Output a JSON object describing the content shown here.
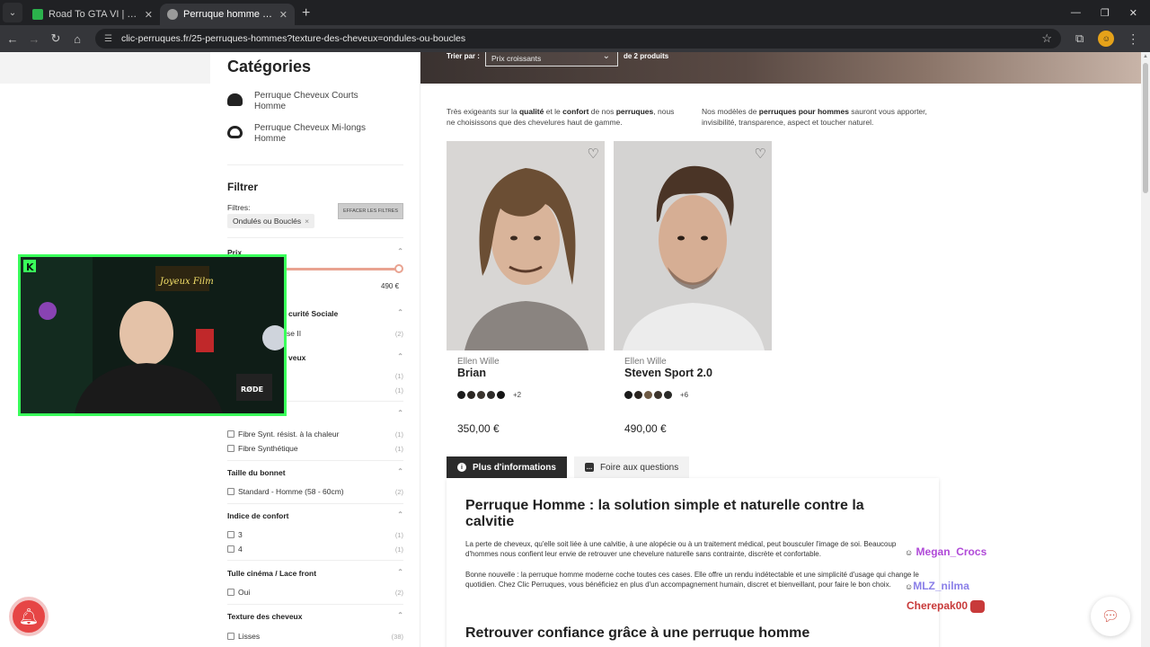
{
  "browser": {
    "tabs": [
      {
        "title": "Road To GTA VI | Twitch.tv/Akan",
        "favicon_color": "#2bb24c"
      },
      {
        "title": "Perruque homme – Cheveux na",
        "favicon_color": "#9a9a9a"
      }
    ],
    "url": "clic-perruques.fr/25-perruques-hommes?texture-des-cheveux=ondules-ou-boucles"
  },
  "sort": {
    "label": "Trier par :",
    "value": "Prix croissants",
    "count": "de 2 produits"
  },
  "sidebar": {
    "title": "Catégories",
    "categories": [
      "Perruque Cheveux Courts Homme",
      "Perruque Cheveux Mi-longs Homme"
    ],
    "filter_title": "Filtrer",
    "filters_label": "Filtres:",
    "active_chip": "Ondulés ou Bouclés",
    "clear_label": "EFFACER LES FILTRES",
    "price_header": "Prix",
    "price_max": "490 €",
    "secu_header": "curité Sociale",
    "secu_opt": "se II",
    "secu_count": "(2)",
    "cheveux_header": "veux",
    "cheveux_counts": [
      "(1)",
      "(1)"
    ],
    "fiber_opts": [
      {
        "label": "Fibre Synt. résist. à la chaleur",
        "count": "(1)"
      },
      {
        "label": "Fibre Synthétique",
        "count": "(1)"
      }
    ],
    "bonnet_header": "Taille du bonnet",
    "bonnet_opt": {
      "label": "Standard - Homme (58 - 60cm)",
      "count": "(2)"
    },
    "confort_header": "Indice de confort",
    "confort_opts": [
      {
        "label": "3",
        "count": "(1)"
      },
      {
        "label": "4",
        "count": "(1)"
      }
    ],
    "tulle_header": "Tulle cinéma / Lace front",
    "tulle_opt": {
      "label": "Oui",
      "count": "(2)"
    },
    "texture_header": "Texture des cheveux",
    "texture_opt": {
      "label": "Lisses",
      "count": "(38)"
    }
  },
  "intro": {
    "left_pre": "Très exigeants sur la ",
    "left_b1": "qualité",
    "left_mid": " et le ",
    "left_b2": "confort",
    "left_mid2": " de nos ",
    "left_b3": "perruques",
    "left_post": ", nous ne choisissons que des chevelures haut de gamme.",
    "right_pre": "Nos modèles de ",
    "right_b": "perruques pour hommes",
    "right_post": " sauront vous apporter, invisibilité, transparence, aspect et toucher naturel."
  },
  "products": [
    {
      "brand": "Ellen Wille",
      "name": "Brian",
      "more": "+2",
      "price": "350,00 €",
      "swatches": [
        "#1b1b1b",
        "#2b2622",
        "#3a342e",
        "#2e2c2a",
        "#151515"
      ]
    },
    {
      "brand": "Ellen Wille",
      "name": "Steven Sport 2.0",
      "more": "+6",
      "price": "490,00 €",
      "swatches": [
        "#1a1a1a",
        "#2a2420",
        "#6e5a44",
        "#3c342c",
        "#2a2a28"
      ]
    }
  ],
  "info_tabs": [
    "Plus d'informations",
    "Foire aux questions"
  ],
  "info": {
    "h1": "Perruque Homme : la solution simple et naturelle contre la calvitie",
    "p1": "La perte de cheveux, qu'elle soit liée à une calvitie, à une alopécie ou à un traitement médical, peut bousculer l'image de soi. Beaucoup d'hommes nous confient leur envie de retrouver une chevelure naturelle sans contrainte, discrète et confortable.",
    "p2": "Bonne nouvelle : la perruque homme moderne coche toutes ces cases. Elle offre un rendu indétectable et une simplicité d'usage qui change le quotidien. Chez Clic Perruques, vous bénéficiez en plus d'un accompagnement humain, discret et bienveillant, pour faire le bon choix.",
    "h2": "Retrouver confiance grâce à une perruque homme"
  },
  "stream_chat": [
    {
      "user": "Megan_Crocs",
      "color": "#b04ad8"
    },
    {
      "user": "MLZ_nilma",
      "color": "#8a7fe8"
    },
    {
      "user": "Cherepak00",
      "color": "#c83a3a"
    }
  ],
  "webcam": {
    "brand_letter": "K",
    "mic_label": "RØDE",
    "neon": "Joyeux Film"
  }
}
